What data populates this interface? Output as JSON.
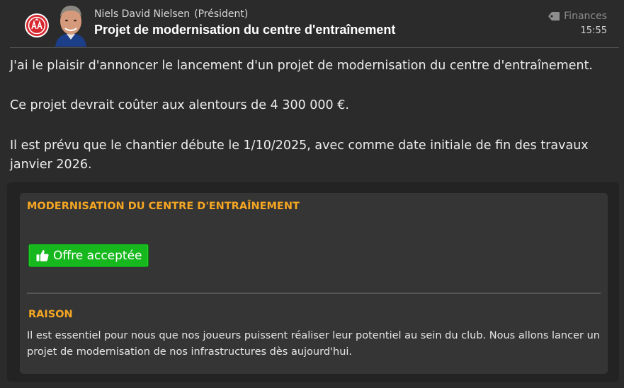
{
  "header": {
    "sender_name": "Niels David Nielsen",
    "sender_role": "(Président)",
    "subject": "Projet de modernisation du centre d'entraînement",
    "category": "Finances",
    "category_icon": "tag-icon",
    "time": "15:55"
  },
  "message": {
    "paragraph_1": "J'ai le plaisir d'annoncer le lancement d'un projet de modernisation du centre d'entraînement.",
    "paragraph_2": "Ce projet devrait coûter aux alentours de 4 300 000 €.",
    "paragraph_3": "Il est prévu que le chantier débute le 1/10/2025, avec comme date initiale de fin des travaux janvier 2026."
  },
  "decision": {
    "title": "MODERNISATION DU CENTRE D'ENTRAÎNEMENT",
    "status_label": "Offre acceptée",
    "status_icon": "thumbs-up-icon",
    "reason_title": "RAISON",
    "reason_text": "Il est essentiel pour nous que nos joueurs puissent réaliser leur potentiel au sein du club. Nous allons lancer un projet de modernisation de nos infrastructures dès aujourd'hui."
  },
  "colors": {
    "background": "#2b2b2b",
    "accent": "#f5a623",
    "accept_green": "#16b81d",
    "badge_red": "#d7262e"
  }
}
